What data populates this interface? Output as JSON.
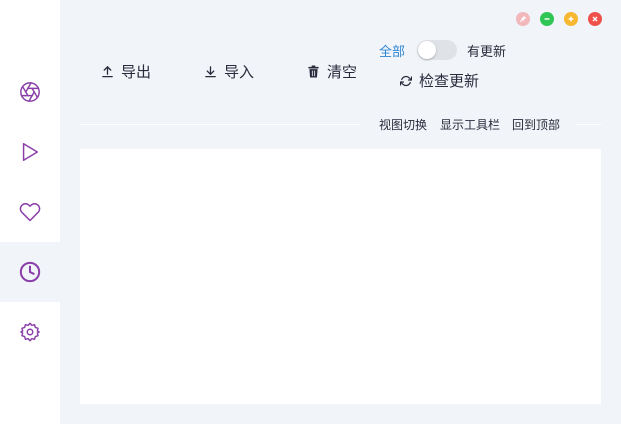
{
  "colors": {
    "accent": "#8a3fa8",
    "link_blue": "#2f86d6",
    "background": "#f1f4f8",
    "pin": "#f2b8bc",
    "minimize": "#2fc655",
    "maximize": "#f7b731",
    "close": "#f0504a"
  },
  "sidebar": {
    "items": [
      {
        "icon": "aperture-icon",
        "active": false
      },
      {
        "icon": "play-icon",
        "active": false
      },
      {
        "icon": "heart-icon",
        "active": false
      },
      {
        "icon": "clock-icon",
        "active": true
      },
      {
        "icon": "settings-icon",
        "active": false
      }
    ]
  },
  "window_controls": [
    "pin-icon",
    "minimize-icon",
    "maximize-icon",
    "close-icon"
  ],
  "toolbar": {
    "export_label": "导出",
    "import_label": "导入",
    "clear_label": "清空",
    "filter_all_label": "全部",
    "filter_updates_label": "有更新",
    "toggle_on": false,
    "check_update_label": "检查更新"
  },
  "links": {
    "switch_view": "视图切换",
    "show_toolbar": "显示工具栏",
    "back_to_top": "回到顶部"
  }
}
